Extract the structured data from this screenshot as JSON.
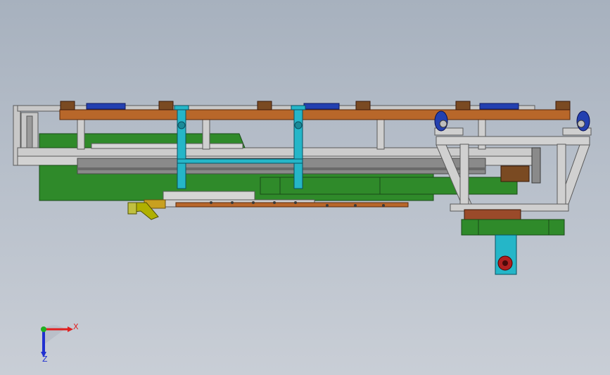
{
  "colors": {
    "frame_gray": "#c8c8c8",
    "frame_edge": "#5a5a5a",
    "beam_orange": "#b8672a",
    "green_plate": "#2f8a2a",
    "cyan_column": "#25b6c8",
    "blue_pad": "#2340b0",
    "dark_block": "#7a4a22",
    "axis_x": "#e02020",
    "axis_y": "#20b020",
    "axis_z": "#2030d0"
  },
  "axis_triad": {
    "x_label": "X",
    "z_label": "Z"
  },
  "icons": [
    "caster-wheel-icon",
    "coordinate-triad-icon"
  ]
}
